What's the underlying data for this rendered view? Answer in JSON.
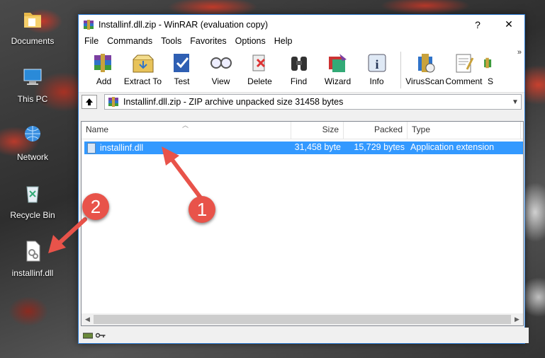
{
  "desktop": {
    "icons": [
      {
        "label": "Documents"
      },
      {
        "label": "This PC"
      },
      {
        "label": "Network"
      },
      {
        "label": "Recycle Bin"
      },
      {
        "label": "installinf.dll"
      }
    ]
  },
  "window": {
    "title": "Installinf.dll.zip - WinRAR (evaluation copy)",
    "help_button": "?",
    "close_button": "✕",
    "menu": [
      "File",
      "Commands",
      "Tools",
      "Favorites",
      "Options",
      "Help"
    ],
    "toolbar": [
      {
        "label": "Add",
        "icon": "add-icon"
      },
      {
        "label": "Extract To",
        "icon": "extract-icon"
      },
      {
        "label": "Test",
        "icon": "test-icon"
      },
      {
        "label": "View",
        "icon": "view-icon"
      },
      {
        "label": "Delete",
        "icon": "delete-icon"
      },
      {
        "label": "Find",
        "icon": "find-icon"
      },
      {
        "label": "Wizard",
        "icon": "wizard-icon"
      },
      {
        "label": "Info",
        "icon": "info-icon"
      },
      {
        "label": "VirusScan",
        "icon": "virusscan-icon"
      },
      {
        "label": "Comment",
        "icon": "comment-icon"
      },
      {
        "label": "S",
        "icon": "sfx-icon"
      }
    ],
    "more_glyph": "»",
    "address": "Installinf.dll.zip - ZIP archive unpacked size 31458 bytes",
    "columns": {
      "name": "Name",
      "size": "Size",
      "packed": "Packed",
      "type": "Type"
    },
    "files": [
      {
        "name": "installinf.dll",
        "size": "31,458 byte",
        "packed": "15,729 bytes",
        "type": "Application extension"
      }
    ]
  },
  "annotations": {
    "badge1": "1",
    "badge2": "2",
    "color": "#e8534a"
  }
}
